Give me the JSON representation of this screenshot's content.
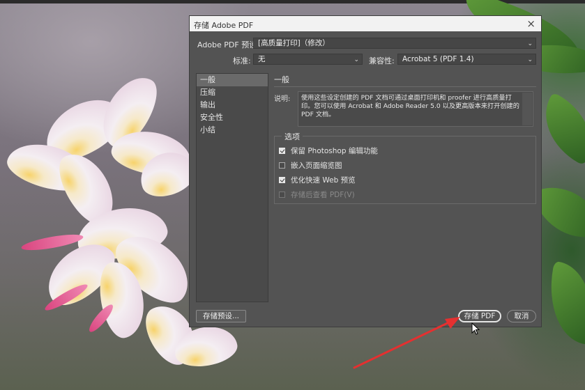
{
  "dialog": {
    "title": "存储 Adobe PDF",
    "preset_label": "Adobe PDF 预设:",
    "preset_value": "[高质量打印]（修改）",
    "standard_label": "标准:",
    "standard_value": "无",
    "compat_label": "兼容性:",
    "compat_value": "Acrobat 5 (PDF 1.4)",
    "sidebar": {
      "items": [
        {
          "label": "一般"
        },
        {
          "label": "压缩"
        },
        {
          "label": "输出"
        },
        {
          "label": "安全性"
        },
        {
          "label": "小结"
        }
      ],
      "active": "一般"
    },
    "section_title": "一般",
    "description_label": "说明:",
    "description": "使用这些设定创建的 PDF 文档可通过桌面打印机和 proofer 进行高质量打印。您可以使用 Acrobat 和 Adobe Reader 5.0 以及更高版本来打开创建的 PDF 文档。",
    "options_label": "选项",
    "options": [
      {
        "label": "保留 Photoshop 编辑功能",
        "checked": true,
        "enabled": true
      },
      {
        "label": "嵌入页面缩览图",
        "checked": false,
        "enabled": true
      },
      {
        "label": "优化快速 Web 预览",
        "checked": true,
        "enabled": true
      },
      {
        "label": "存储后查看 PDF(V)",
        "checked": false,
        "enabled": false
      }
    ],
    "save_preset_button": "存储预设...",
    "save_pdf_button": "存储 PDF",
    "cancel_button": "取消"
  },
  "icons": {
    "close": "close-icon",
    "dropdown": "chevron-down-icon",
    "checkbox": "checkbox-icon",
    "cursor": "mouse-cursor-icon",
    "annotation": "red-arrow-icon"
  },
  "colors": {
    "dialog_bg": "#535353",
    "titlebar_bg": "#f2f2f2",
    "annotation_arrow": "#e53030"
  }
}
